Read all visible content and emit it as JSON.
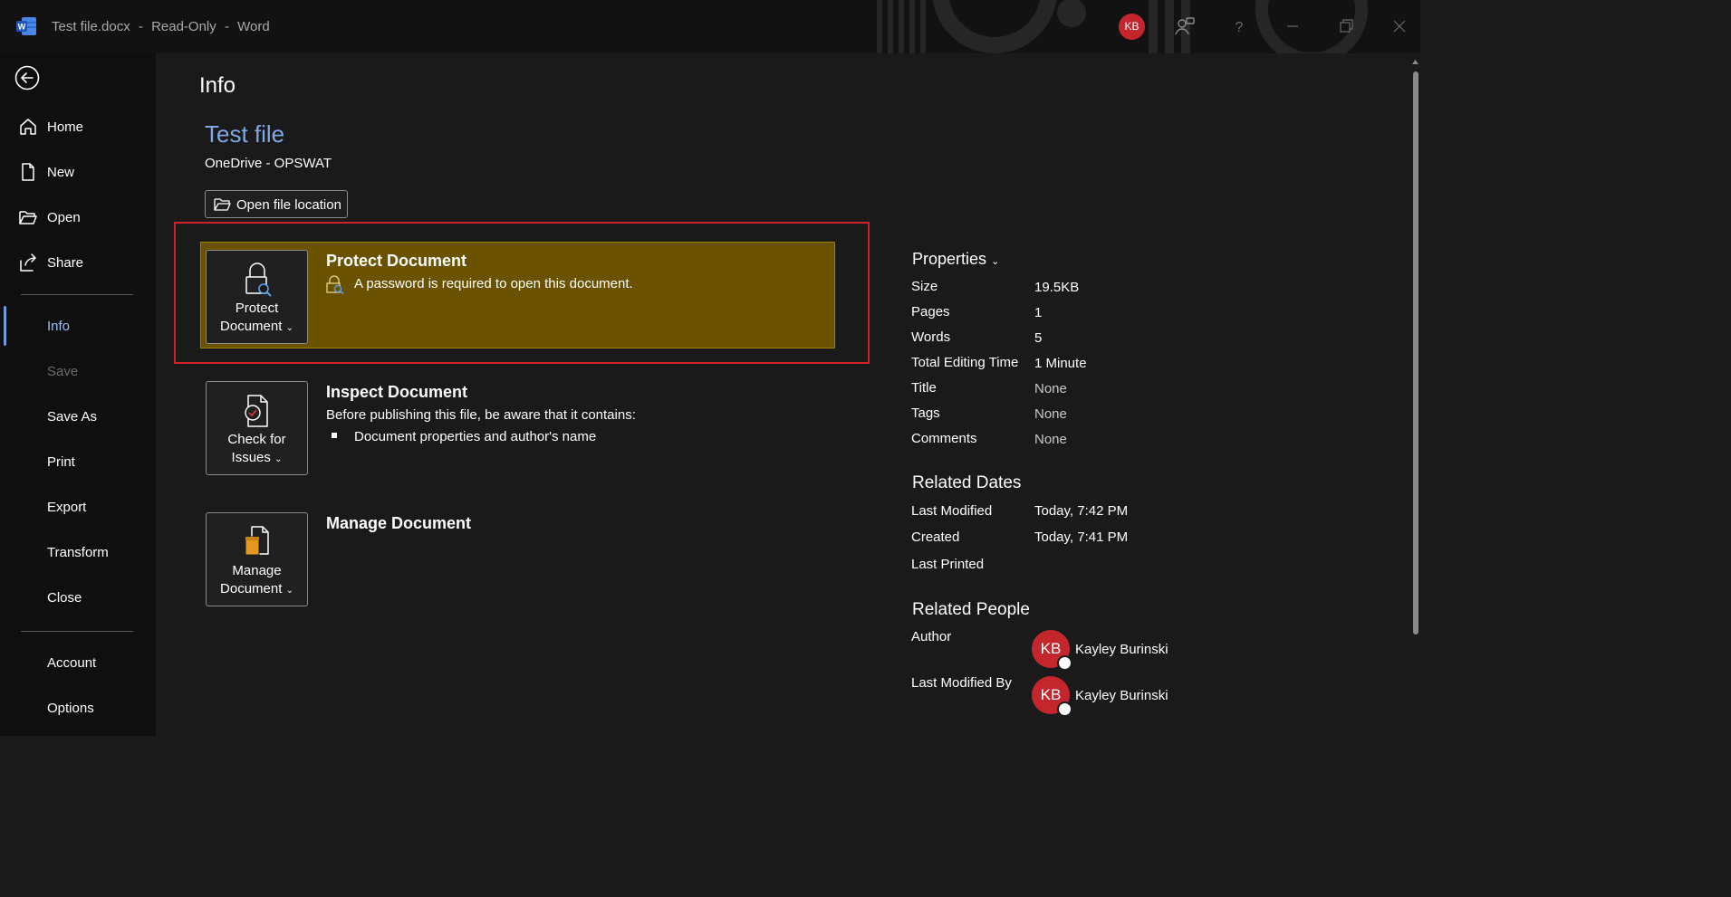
{
  "titlebar": {
    "file_name": "Test file.docx",
    "mode": "Read-Only",
    "app": "Word",
    "separator": "-",
    "user_initials": "KB"
  },
  "nav": {
    "items": [
      {
        "label": "Home"
      },
      {
        "label": "New"
      },
      {
        "label": "Open"
      },
      {
        "label": "Share"
      },
      {
        "label": "Info"
      },
      {
        "label": "Save"
      },
      {
        "label": "Save As"
      },
      {
        "label": "Print"
      },
      {
        "label": "Export"
      },
      {
        "label": "Transform"
      },
      {
        "label": "Close"
      },
      {
        "label": "Account"
      },
      {
        "label": "Options"
      }
    ]
  },
  "main": {
    "heading": "Info",
    "doc_title": "Test file",
    "doc_location": "OneDrive - OPSWAT",
    "open_location_label": "Open file location",
    "protect": {
      "tile_line1": "Protect",
      "tile_line2": "Document",
      "title": "Protect Document",
      "description": "A password is required to open this document."
    },
    "inspect": {
      "tile_line1": "Check for",
      "tile_line2": "Issues",
      "title": "Inspect Document",
      "description": "Before publishing this file, be aware that it contains:",
      "bullet": "Document properties and author's name"
    },
    "manage": {
      "tile_line1": "Manage",
      "tile_line2": "Document",
      "title": "Manage Document"
    }
  },
  "properties": {
    "heading": "Properties",
    "rows": [
      {
        "label": "Size",
        "value": "19.5KB"
      },
      {
        "label": "Pages",
        "value": "1"
      },
      {
        "label": "Words",
        "value": "5"
      },
      {
        "label": "Total Editing Time",
        "value": "1 Minute"
      },
      {
        "label": "Title",
        "value": "None"
      },
      {
        "label": "Tags",
        "value": "None"
      },
      {
        "label": "Comments",
        "value": "None"
      }
    ],
    "related_dates": {
      "heading": "Related Dates",
      "rows": [
        {
          "label": "Last Modified",
          "value": "Today, 7:42 PM"
        },
        {
          "label": "Created",
          "value": "Today, 7:41 PM"
        },
        {
          "label": "Last Printed",
          "value": ""
        }
      ]
    },
    "related_people": {
      "heading": "Related People",
      "author_label": "Author",
      "author_initials": "KB",
      "author_name": "Kayley Burinski",
      "modified_by_label": "Last Modified By",
      "modified_by_initials": "KB",
      "modified_by_name": "Kayley Burinski"
    }
  },
  "colors": {
    "accent": "#7ea8e6",
    "highlight_border": "#d0202a",
    "protect_bg": "#6b5200",
    "avatar": "#c4262e"
  }
}
